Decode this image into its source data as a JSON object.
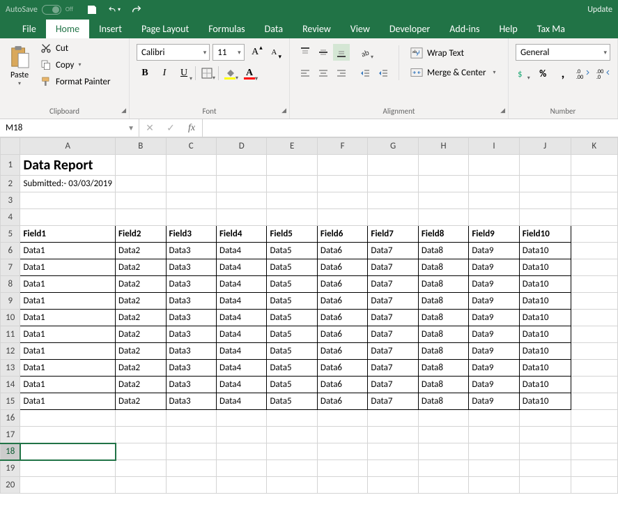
{
  "titleBar": {
    "autoSave": "AutoSave",
    "autoSaveState": "Off",
    "updater": "Update"
  },
  "tabs": [
    "File",
    "Home",
    "Insert",
    "Page Layout",
    "Formulas",
    "Data",
    "Review",
    "View",
    "Developer",
    "Add-ins",
    "Help",
    "Tax Ma"
  ],
  "activeTab": "Home",
  "clipboard": {
    "paste": "Paste",
    "cut": "Cut",
    "copy": "Copy",
    "formatPainter": "Format Painter",
    "group": "Clipboard"
  },
  "font": {
    "name": "Calibri",
    "size": "11",
    "group": "Font"
  },
  "alignment": {
    "wrap": "Wrap Text",
    "merge": "Merge & Center",
    "group": "Alignment"
  },
  "number": {
    "format": "General",
    "group": "Number"
  },
  "nameBox": "M18",
  "formula": "",
  "columns": [
    "A",
    "B",
    "C",
    "D",
    "E",
    "F",
    "G",
    "H",
    "I",
    "J",
    "K"
  ],
  "rowCount": 20,
  "sheet": {
    "title": "Data Report",
    "submitted": "Submitted:- 03/03/2019",
    "headers": [
      "Field1",
      "Field2",
      "Field3",
      "Field4",
      "Field5",
      "Field6",
      "Field7",
      "Field8",
      "Field9",
      "Field10"
    ],
    "rows": [
      [
        "Data1",
        "Data2",
        "Data3",
        "Data4",
        "Data5",
        "Data6",
        "Data7",
        "Data8",
        "Data9",
        "Data10"
      ],
      [
        "Data1",
        "Data2",
        "Data3",
        "Data4",
        "Data5",
        "Data6",
        "Data7",
        "Data8",
        "Data9",
        "Data10"
      ],
      [
        "Data1",
        "Data2",
        "Data3",
        "Data4",
        "Data5",
        "Data6",
        "Data7",
        "Data8",
        "Data9",
        "Data10"
      ],
      [
        "Data1",
        "Data2",
        "Data3",
        "Data4",
        "Data5",
        "Data6",
        "Data7",
        "Data8",
        "Data9",
        "Data10"
      ],
      [
        "Data1",
        "Data2",
        "Data3",
        "Data4",
        "Data5",
        "Data6",
        "Data7",
        "Data8",
        "Data9",
        "Data10"
      ],
      [
        "Data1",
        "Data2",
        "Data3",
        "Data4",
        "Data5",
        "Data6",
        "Data7",
        "Data8",
        "Data9",
        "Data10"
      ],
      [
        "Data1",
        "Data2",
        "Data3",
        "Data4",
        "Data5",
        "Data6",
        "Data7",
        "Data8",
        "Data9",
        "Data10"
      ],
      [
        "Data1",
        "Data2",
        "Data3",
        "Data4",
        "Data5",
        "Data6",
        "Data7",
        "Data8",
        "Data9",
        "Data10"
      ],
      [
        "Data1",
        "Data2",
        "Data3",
        "Data4",
        "Data5",
        "Data6",
        "Data7",
        "Data8",
        "Data9",
        "Data10"
      ],
      [
        "Data1",
        "Data2",
        "Data3",
        "Data4",
        "Data5",
        "Data6",
        "Data7",
        "Data8",
        "Data9",
        "Data10"
      ]
    ]
  },
  "activeRow": 18
}
